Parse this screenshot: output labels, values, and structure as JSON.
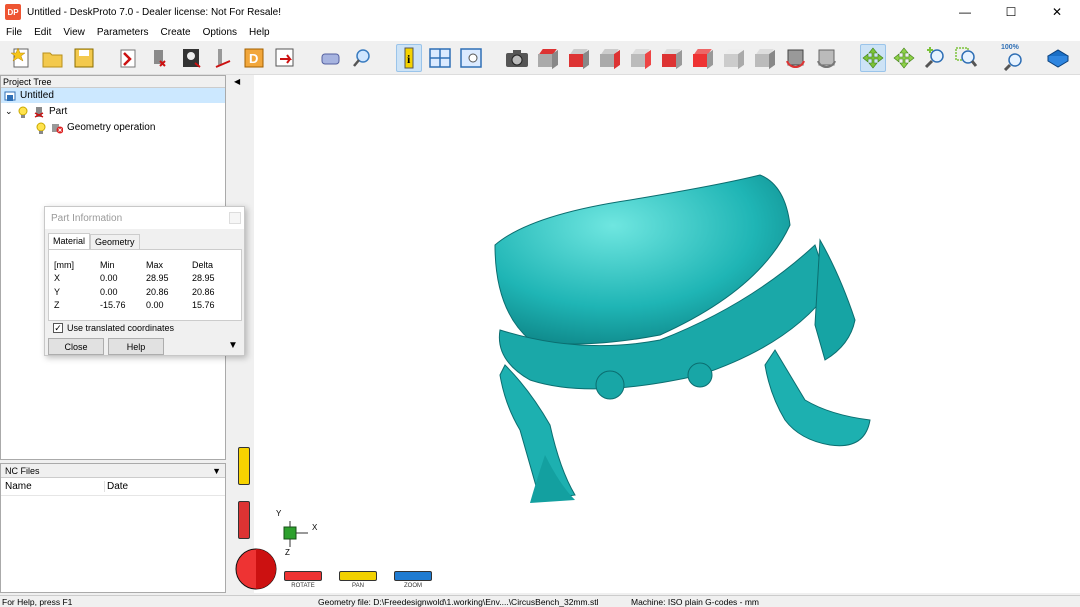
{
  "window": {
    "title": "Untitled - DeskProto 7.0 - Dealer license: Not For Resale!",
    "app_icon": "DP",
    "controls": [
      "—",
      "☐",
      "✕"
    ]
  },
  "menu": [
    "File",
    "Edit",
    "View",
    "Parameters",
    "Create",
    "Options",
    "Help"
  ],
  "toolbar": {
    "zoom_label": "100%"
  },
  "project_tree": {
    "header": "Project Tree",
    "items": [
      {
        "label": "Untitled",
        "selected": true
      },
      {
        "label": "Part"
      },
      {
        "label": "Geometry operation"
      }
    ]
  },
  "nc_files": {
    "header": "NC Files",
    "columns": [
      "Name",
      "Date"
    ]
  },
  "part_information": {
    "title": "Part Information",
    "tabs": [
      "Material",
      "Geometry"
    ],
    "headers": [
      "[mm]",
      "Min",
      "Max",
      "Delta"
    ],
    "rows": [
      [
        "X",
        "0.00",
        "28.95",
        "28.95"
      ],
      [
        "Y",
        "0.00",
        "20.86",
        "20.86"
      ],
      [
        "Z",
        "-15.76",
        "0.00",
        "15.76"
      ]
    ],
    "checkbox_label": "Use translated coordinates",
    "checkbox_checked": true,
    "close_label": "Close",
    "help_label": "Help"
  },
  "navigation": {
    "rotate": "ROTATE",
    "pan": "PAN",
    "zoom": "ZOOM"
  },
  "axes": {
    "x": "X",
    "y": "Y",
    "z": "Z"
  },
  "status": {
    "help": "For Help, press F1",
    "geometry": "Geometry file: D:\\Freedesignwold\\1.working\\Env....\\CircusBench_32mm.stl",
    "machine": "Machine: ISO plain G-codes - mm"
  },
  "colors": {
    "model": "#1fb5b5",
    "accent": "#0078d7"
  }
}
